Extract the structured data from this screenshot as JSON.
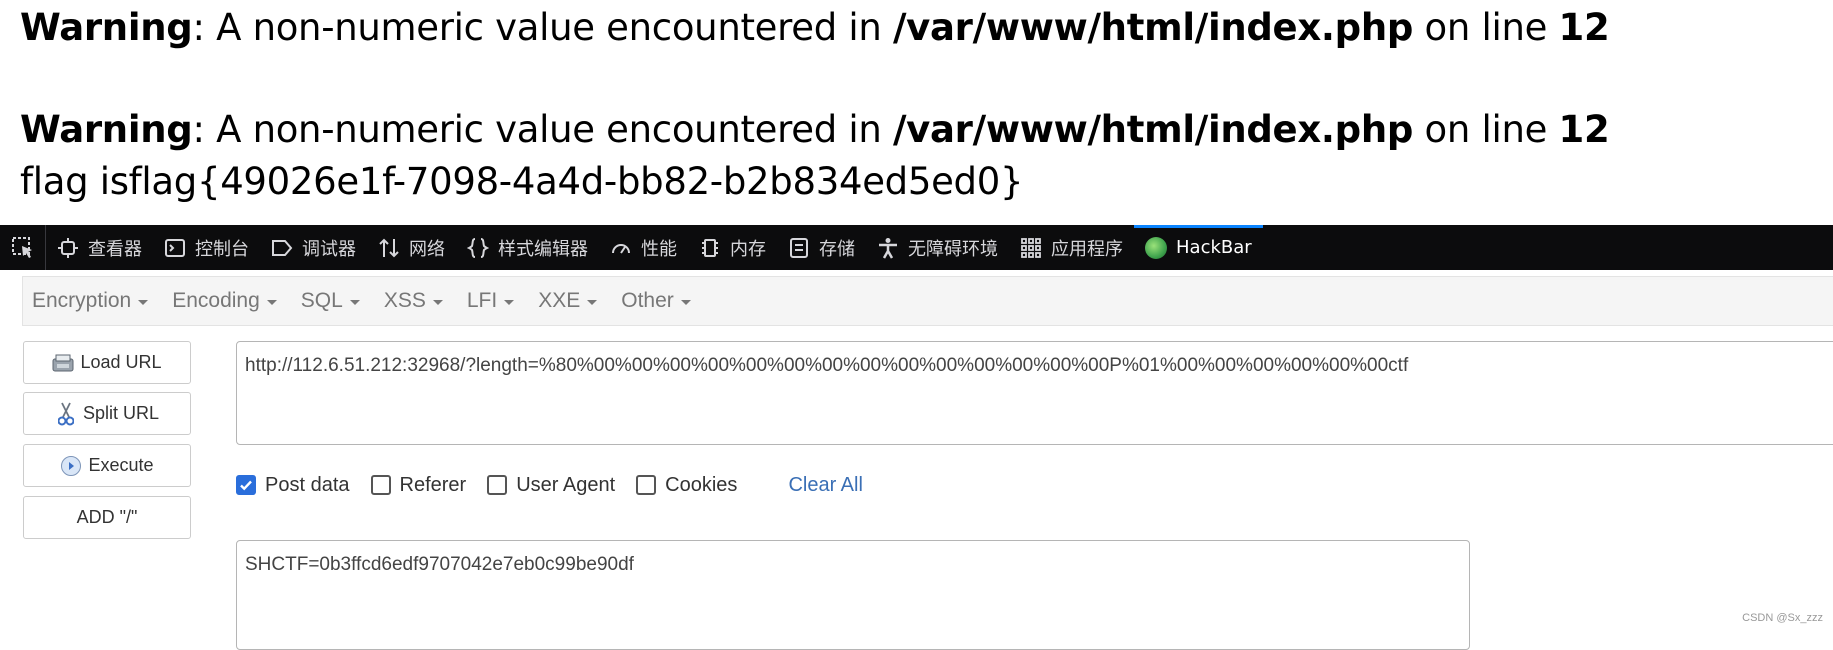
{
  "php_output": {
    "warnings": [
      {
        "label": "Warning",
        "message": ": A non-numeric value encountered in ",
        "file": "/var/www/html/index.php",
        "on_line_text": " on line ",
        "line": "12"
      },
      {
        "label": "Warning",
        "message": ": A non-numeric value encountered in ",
        "file": "/var/www/html/index.php",
        "on_line_text": " on line ",
        "line": "12"
      }
    ],
    "flag_line": "flag isflag{49026e1f-7098-4a4d-bb82-b2b834ed5ed0}"
  },
  "devtools": {
    "tabs": [
      {
        "label": "查看器",
        "icon": "inspector-icon"
      },
      {
        "label": "控制台",
        "icon": "console-icon"
      },
      {
        "label": "调试器",
        "icon": "debugger-icon"
      },
      {
        "label": "网络",
        "icon": "network-icon"
      },
      {
        "label": "样式编辑器",
        "icon": "style-editor-icon"
      },
      {
        "label": "性能",
        "icon": "performance-icon"
      },
      {
        "label": "内存",
        "icon": "memory-icon"
      },
      {
        "label": "存储",
        "icon": "storage-icon"
      },
      {
        "label": "无障碍环境",
        "icon": "accessibility-icon"
      },
      {
        "label": "应用程序",
        "icon": "application-icon"
      },
      {
        "label": "HackBar",
        "icon": "hackbar-icon"
      }
    ],
    "active_tab": "HackBar",
    "active_color": "#0a84ff"
  },
  "hackbar": {
    "menus": [
      "Encryption",
      "Encoding",
      "SQL",
      "XSS",
      "LFI",
      "XXE",
      "Other"
    ],
    "buttons": {
      "load_url": "Load URL",
      "split_url": "Split URL",
      "execute": "Execute",
      "add_slash": "ADD \"/\""
    },
    "url_value": "http://112.6.51.212:32968/?length=%80%00%00%00%00%00%00%00%00%00%00%00%00%00%00P%01%00%00%00%00%00%00ctf",
    "options": {
      "post_data": {
        "label": "Post data",
        "checked": true
      },
      "referer": {
        "label": "Referer",
        "checked": false
      },
      "user_agent": {
        "label": "User Agent",
        "checked": false
      },
      "cookies": {
        "label": "Cookies",
        "checked": false
      }
    },
    "clear_all": "Clear All",
    "post_value": "SHCTF=0b3ffcd6edf9707042e7eb0c99be90df"
  },
  "watermark": "CSDN @Sx_zzz"
}
